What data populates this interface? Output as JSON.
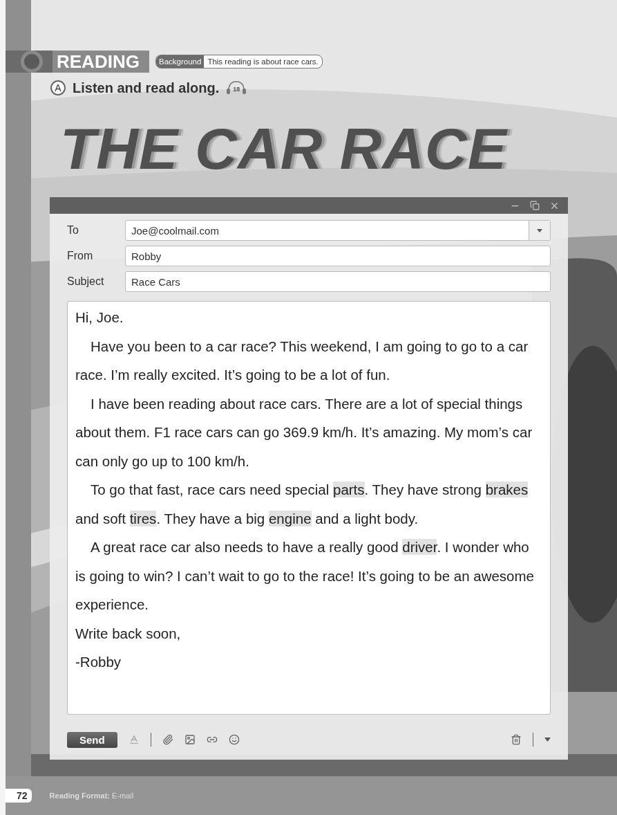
{
  "header": {
    "section": "READING",
    "background_label": "Background",
    "background_text": "This reading is about race cars."
  },
  "instruction": {
    "letter": "A",
    "text": "Listen and read along.",
    "track": "18"
  },
  "title": "THE CAR RACE",
  "email": {
    "fields": [
      {
        "label": "To",
        "value": "Joe@coolmail.com",
        "kind": "dropdown"
      },
      {
        "label": "From",
        "value": "Robby",
        "kind": "text"
      },
      {
        "label": "Subject",
        "value": "Race Cars",
        "kind": "text"
      }
    ],
    "body": [
      {
        "indent": false,
        "segments": [
          {
            "text": "Hi, Joe.",
            "highlight": false
          }
        ]
      },
      {
        "indent": true,
        "segments": [
          {
            "text": "Have you been to a car race? This weekend, I am going to go to a car race. I’m really excited.  It’s going to be a lot of fun.",
            "highlight": false
          }
        ]
      },
      {
        "indent": true,
        "segments": [
          {
            "text": "I have been reading about race cars. There are a lot of special things about them. F1 race cars can go 369.9 km/h.  It’s amazing. My mom’s car can only go up to 100 km/h.",
            "highlight": false
          }
        ]
      },
      {
        "indent": true,
        "segments": [
          {
            "text": "To go that fast, race cars need special ",
            "highlight": false
          },
          {
            "text": "parts",
            "highlight": true
          },
          {
            "text": ". They have strong ",
            "highlight": false
          },
          {
            "text": "brakes",
            "highlight": true
          },
          {
            "text": " and soft ",
            "highlight": false
          },
          {
            "text": "tires",
            "highlight": true
          },
          {
            "text": ". They have a big ",
            "highlight": false
          },
          {
            "text": "engine",
            "highlight": true
          },
          {
            "text": " and a light body.",
            "highlight": false
          }
        ]
      },
      {
        "indent": true,
        "segments": [
          {
            "text": "A great race car also needs to have a really good ",
            "highlight": false
          },
          {
            "text": "driver",
            "highlight": true
          },
          {
            "text": ". I wonder who is going to win? I can’t wait to go to the race! It’s going to be an awesome experience.",
            "highlight": false
          }
        ]
      },
      {
        "indent": false,
        "segments": [
          {
            "text": "Write back soon,",
            "highlight": false
          }
        ]
      },
      {
        "indent": false,
        "segments": [
          {
            "text": "-Robby",
            "highlight": false
          }
        ]
      }
    ],
    "send": "Send"
  },
  "footer": {
    "page": "72",
    "format": "**Reading Format:** E-mail"
  }
}
